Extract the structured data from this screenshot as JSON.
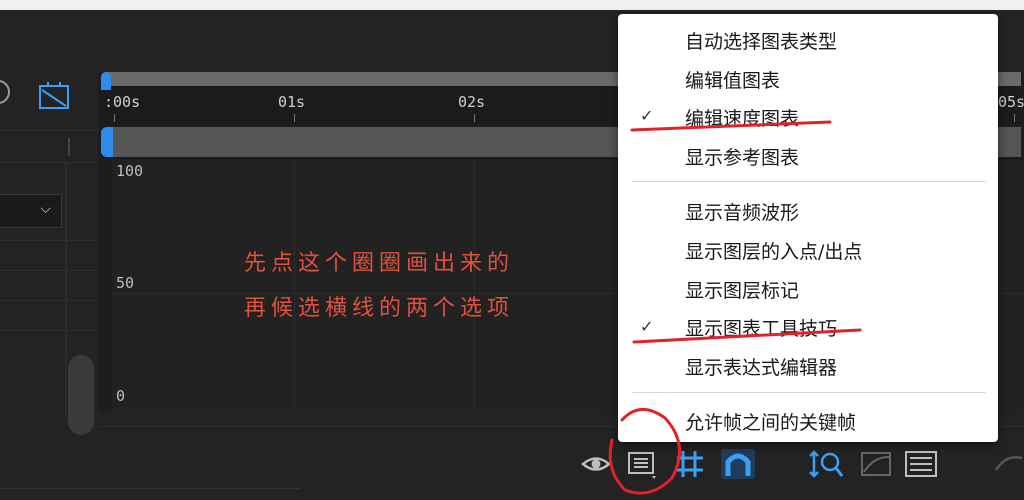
{
  "timeline": {
    "ticks": [
      ":00s",
      "01s",
      "02s",
      "05s"
    ],
    "y_labels": {
      "top": "100",
      "mid": "50",
      "bottom": "0"
    }
  },
  "annotation": {
    "line1": "先点这个圈圈画出来的",
    "line2": "再候选横线的两个选项"
  },
  "menu": {
    "items": [
      {
        "label": "自动选择图表类型",
        "checked": false
      },
      {
        "label": "编辑值图表",
        "checked": false
      },
      {
        "label": "编辑速度图表",
        "checked": true
      },
      {
        "label": "显示参考图表",
        "checked": false
      },
      {
        "label": "显示音频波形",
        "checked": false
      },
      {
        "label": "显示图层的入点/出点",
        "checked": false
      },
      {
        "label": "显示图层标记",
        "checked": false
      },
      {
        "label": "显示图表工具技巧",
        "checked": true
      },
      {
        "label": "显示表达式编辑器",
        "checked": false
      },
      {
        "label": "允许帧之间的关键帧",
        "checked": false
      }
    ],
    "check_glyph": "✓"
  },
  "colors": {
    "accent": "#2d8ceb",
    "annotation": "#e0513e",
    "menu_bg": "#ffffff"
  },
  "icons": [
    "eye-icon",
    "graph-options-icon",
    "grid-snap-icon",
    "magnet-icon",
    "fit-zoom-icon",
    "graph-editor-icon",
    "frame-icon",
    "curve-icon"
  ]
}
